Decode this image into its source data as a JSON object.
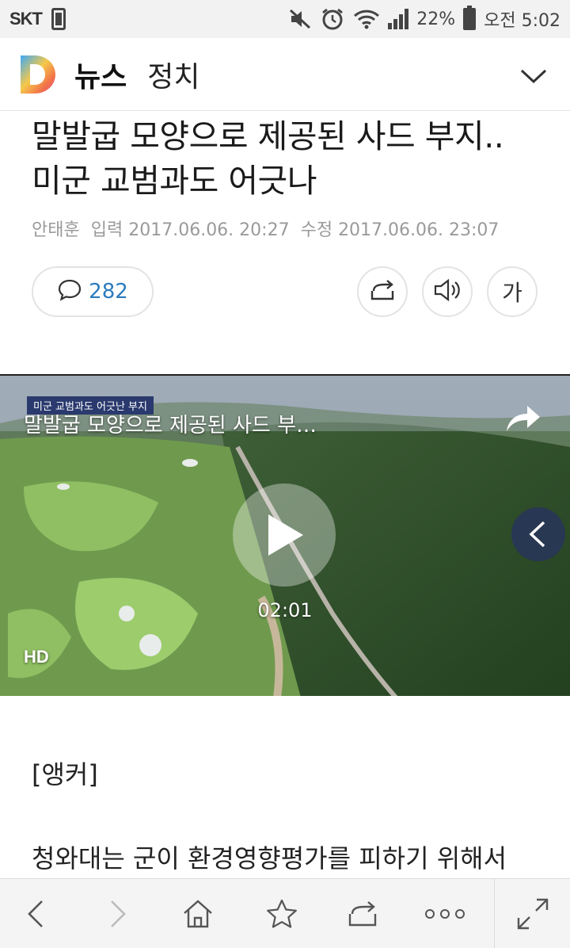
{
  "status_bar": {
    "carrier": "SKT",
    "battery": "22%",
    "time": "오전 5:02"
  },
  "app_bar": {
    "title": "뉴스",
    "section": "정치"
  },
  "article": {
    "title_line1": "말발굽 모양으로 제공된 사드 부지..",
    "title_line2": "미군 교범과도 어긋나",
    "author": "안태훈",
    "input_label": "입력",
    "input_date": "2017.06.06. 20:27",
    "edit_label": "수정",
    "edit_date": "2017.06.06. 23:07",
    "comment_count": "282",
    "font_button_label": "가"
  },
  "video": {
    "caption_tag": "미군 교범과도 어긋난 부지",
    "title": "말발굽 모양으로 제공된 사드 부…",
    "duration": "02:01",
    "quality": "HD"
  },
  "body": {
    "anchor": "[앵커]",
    "first_line": "청와대는 군이 환경영향평가를 피하기 위해서"
  },
  "colors": {
    "accent_blue": "#2b7bbd",
    "status_bg": "#f2f2f2",
    "toolbar_bg": "#f4f4f4"
  }
}
